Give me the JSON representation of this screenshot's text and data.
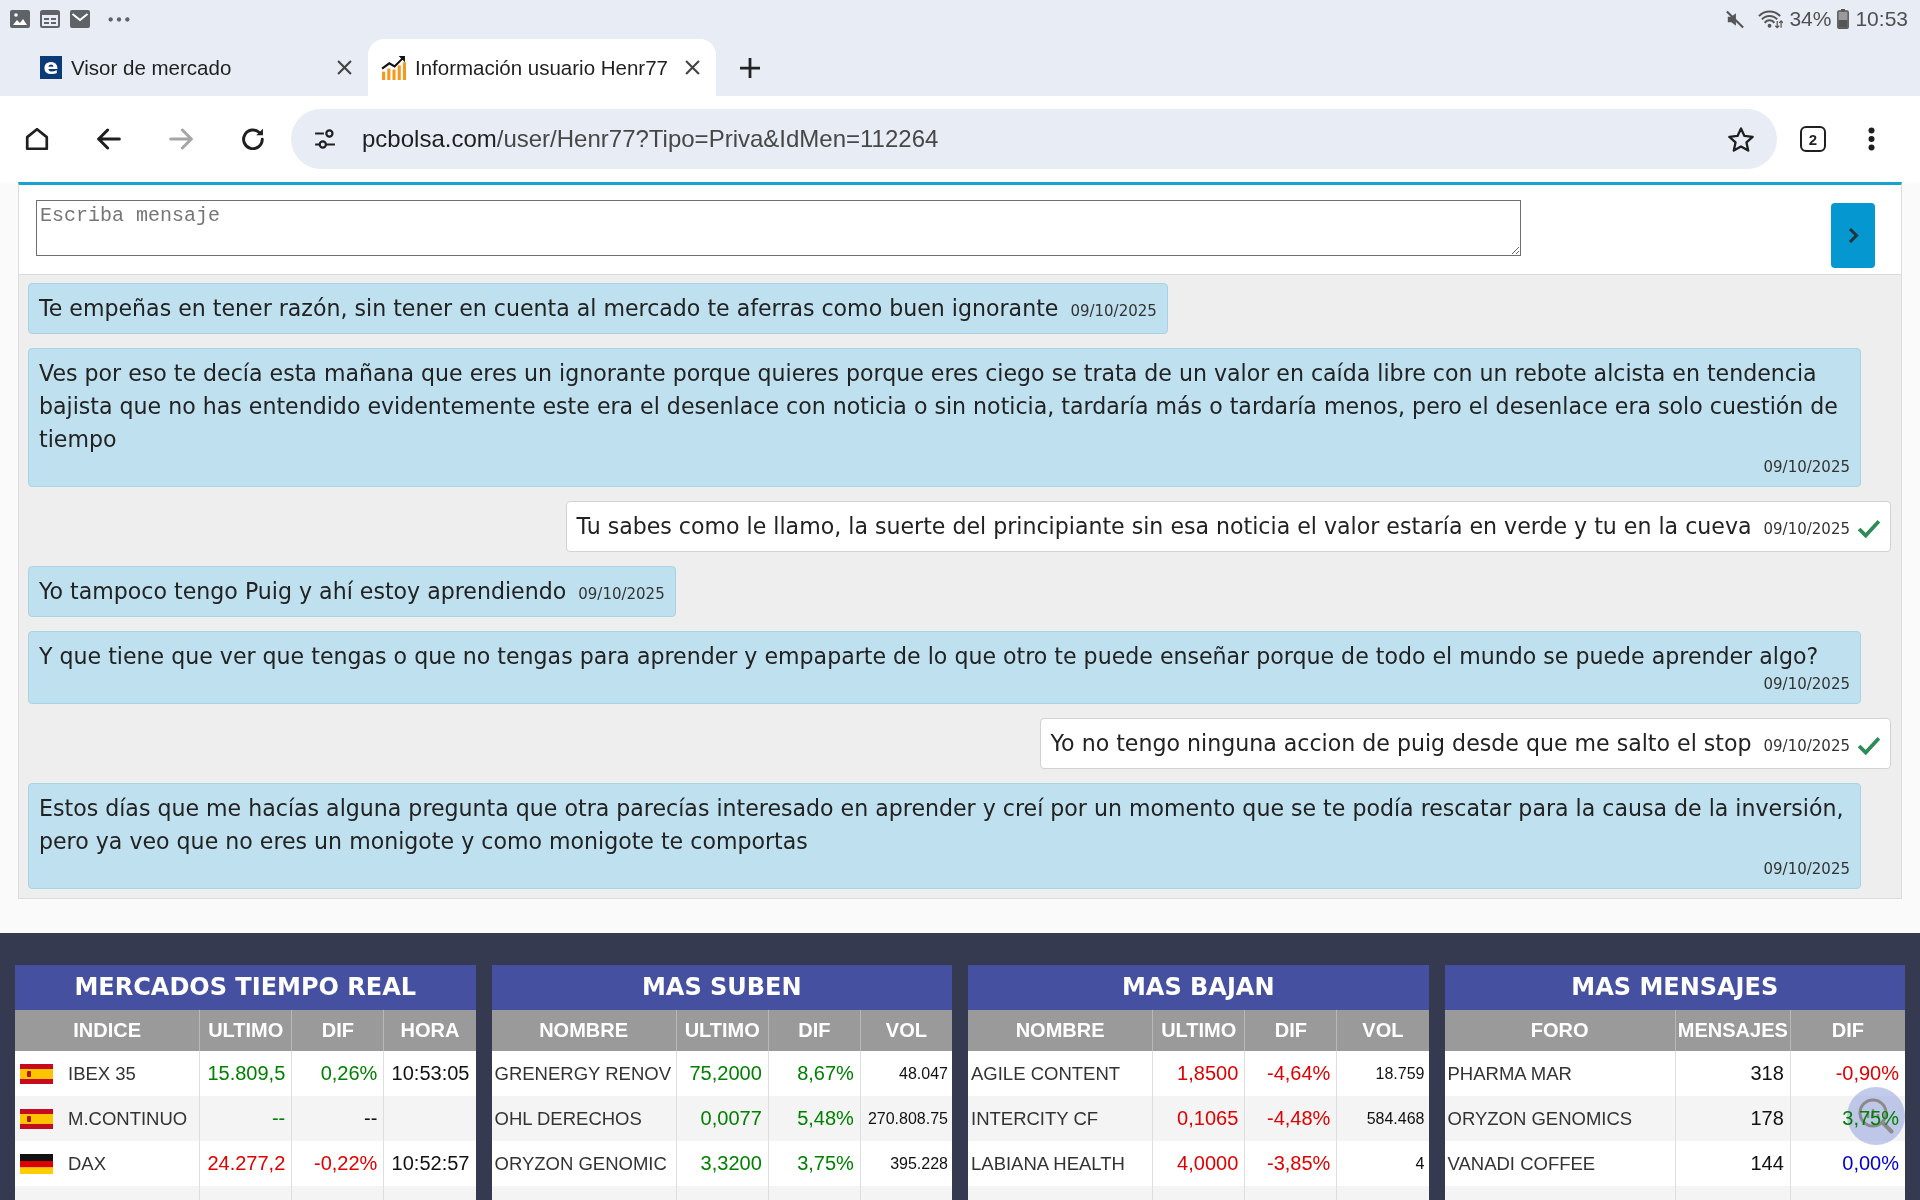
{
  "status_bar": {
    "notifications": [
      {
        "kind": "image"
      },
      {
        "kind": "calendar"
      },
      {
        "kind": "mail"
      },
      {
        "kind": "more"
      }
    ],
    "muted": true,
    "battery": "34%",
    "time": "10:53"
  },
  "tabs": [
    {
      "title": "Visor de mercado",
      "selected": false,
      "favicon": {
        "kind": "letter",
        "text": "e"
      }
    },
    {
      "title": "Información usuario Henr77",
      "selected": true,
      "favicon": {
        "kind": "chart"
      }
    }
  ],
  "toolbar": {
    "nav": [
      {
        "kind": "home",
        "disabled": false
      },
      {
        "kind": "back",
        "disabled": false
      },
      {
        "kind": "forward",
        "disabled": true
      },
      {
        "kind": "reload",
        "disabled": false
      }
    ],
    "url": {
      "host": "pcbolsa.com",
      "path": "/user/Henr77?Tipo=Priva&IdMen=112264"
    },
    "tab_count": "2"
  },
  "composer": {
    "placeholder": "Escriba mensaje"
  },
  "messages": [
    {
      "kind": "received",
      "text": "Te empeñas en tener razón, sin tener en cuenta al mercado te aferras como buen ignorante",
      "date": "09/10/2025"
    },
    {
      "kind": "received",
      "text": "Ves por eso te decía esta mañana que eres un ignorante porque quieres porque eres ciego se trata de un valor en caída libre con un rebote alcista en tendencia bajista que no has entendido evidentemente este era el desenlace con noticia o sin noticia, tardaría más o tardaría menos, pero el desenlace era solo cuestión de tiempo",
      "date": "09/10/2025"
    },
    {
      "kind": "sent",
      "text": "Tu sabes como le llamo, la suerte del principiante sin esa noticia el valor estaría en verde y tu en la cueva",
      "date": "09/10/2025"
    },
    {
      "kind": "received",
      "text": "Yo tampoco tengo Puig y ahí estoy aprendiendo",
      "date": "09/10/2025"
    },
    {
      "kind": "received",
      "text": "Y que tiene que ver que tengas o que no tengas para aprender y empaparte de lo que otro te puede enseñar porque de todo el mundo se puede aprender algo?",
      "date": "09/10/2025"
    },
    {
      "kind": "sent",
      "text": "Yo no tengo ninguna accion de puig desde que me salto el stop",
      "date": "09/10/2025"
    },
    {
      "kind": "received",
      "text": "Estos días que me hacías alguna pregunta que otra parecías interesado en aprender y creí por un momento que se te podía rescatar para la causa de la inversión, pero ya veo que no eres un monigote y como monigote te comportas",
      "date": "09/10/2025"
    }
  ],
  "panels": [
    {
      "kind": "index",
      "title": "MERCADOS TIEMPO REAL",
      "columns": [
        "INDICE",
        "ULTIMO",
        "DIF",
        "HORA"
      ],
      "rows": [
        {
          "kind": "spain",
          "cells": [
            {
              "text": "IBEX 35"
            },
            {
              "text": "15.809,5",
              "color": "#008000"
            },
            {
              "text": "0,26%",
              "color": "#008000"
            },
            {
              "text": "10:53:05"
            }
          ]
        },
        {
          "kind": "spain",
          "cells": [
            {
              "text": "M.CONTINUO"
            },
            {
              "text": "--",
              "color": "#008000"
            },
            {
              "text": "--"
            }
          ]
        },
        {
          "kind": "germany",
          "cells": [
            {
              "text": "DAX"
            },
            {
              "text": "24.277,2",
              "color": "#e00000"
            },
            {
              "text": "-0,22%",
              "color": "#e00000"
            },
            {
              "text": "10:52:57"
            }
          ]
        }
      ]
    },
    {
      "kind": "movers",
      "title": "MAS SUBEN",
      "columns": [
        "NOMBRE",
        "ULTIMO",
        "DIF",
        "VOL"
      ],
      "rows": [
        {
          "cells": [
            {
              "text": "GRENERGY RENOV"
            },
            {
              "text": "75,2000",
              "color": "#008000"
            },
            {
              "text": "8,67%",
              "color": "#008000"
            },
            {
              "text": "48.047"
            }
          ]
        },
        {
          "cells": [
            {
              "text": "OHL DERECHOS"
            },
            {
              "text": "0,0077",
              "color": "#008000"
            },
            {
              "text": "5,48%",
              "color": "#008000"
            },
            {
              "text": "270.808.75"
            }
          ]
        },
        {
          "cells": [
            {
              "text": "ORYZON GENOMIC"
            },
            {
              "text": "3,3200",
              "color": "#008000"
            },
            {
              "text": "3,75%",
              "color": "#008000"
            },
            {
              "text": "395.228"
            }
          ]
        }
      ]
    },
    {
      "kind": "movers",
      "title": "MAS BAJAN",
      "columns": [
        "NOMBRE",
        "ULTIMO",
        "DIF",
        "VOL"
      ],
      "rows": [
        {
          "cells": [
            {
              "text": "AGILE CONTENT"
            },
            {
              "text": "1,8500",
              "color": "#e00000"
            },
            {
              "text": "-4,64%",
              "color": "#e00000"
            },
            {
              "text": "18.759"
            }
          ]
        },
        {
          "cells": [
            {
              "text": "INTERCITY CF"
            },
            {
              "text": "0,1065",
              "color": "#e00000"
            },
            {
              "text": "-4,48%",
              "color": "#e00000"
            },
            {
              "text": "584.468"
            }
          ]
        },
        {
          "cells": [
            {
              "text": "LABIANA HEALTH"
            },
            {
              "text": "4,0000",
              "color": "#e00000"
            },
            {
              "text": "-3,85%",
              "color": "#e00000"
            },
            {
              "text": "4"
            }
          ]
        }
      ]
    },
    {
      "kind": "forum",
      "title": "MAS MENSAJES",
      "columns": [
        "FORO",
        "MENSAJES",
        "DIF"
      ],
      "rows": [
        {
          "cells": [
            {
              "text": "PHARMA MAR"
            },
            {
              "text": "318"
            },
            {
              "text": "-0,90%",
              "color": "#e00000"
            }
          ]
        },
        {
          "cells": [
            {
              "text": "ORYZON GENOMICS"
            },
            {
              "text": "178"
            },
            {
              "text": "3,75%",
              "color": "#008000"
            }
          ]
        },
        {
          "cells": [
            {
              "text": "VANADI COFFEE"
            },
            {
              "text": "144"
            },
            {
              "text": "0,00%",
              "color": "#0000cc"
            }
          ]
        }
      ]
    }
  ]
}
